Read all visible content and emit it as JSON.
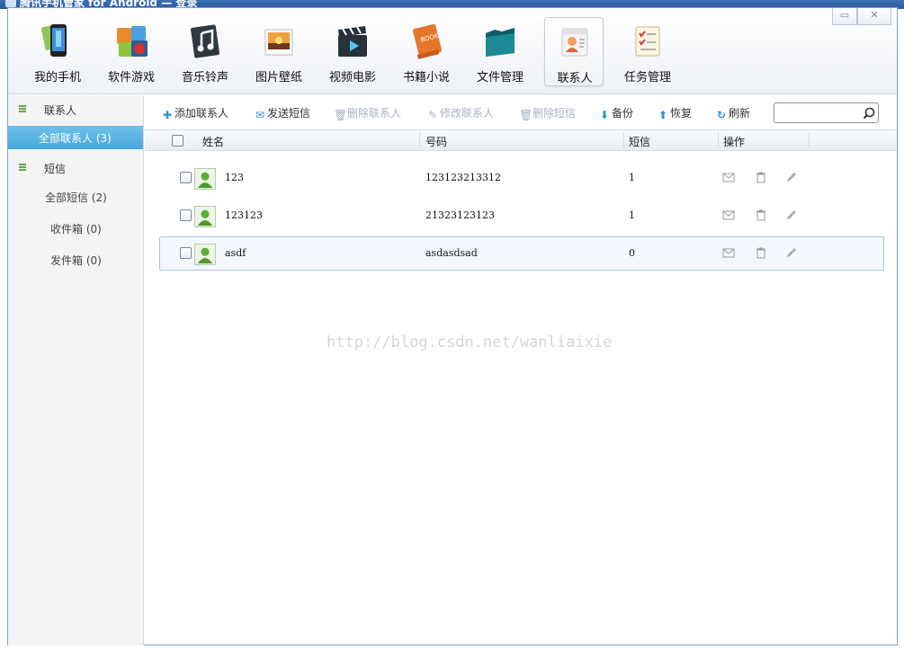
{
  "window": {
    "title": "腾讯手机管家 for Android — 登录",
    "minimize_label": "▭",
    "close_label": "✕"
  },
  "nav": {
    "items": [
      {
        "label": "我的手机",
        "icon": "phone-icon"
      },
      {
        "label": "软件游戏",
        "icon": "apps-games-icon"
      },
      {
        "label": "音乐铃声",
        "icon": "music-icon"
      },
      {
        "label": "图片壁纸",
        "icon": "wallpaper-icon"
      },
      {
        "label": "视频电影",
        "icon": "video-icon"
      },
      {
        "label": "书籍小说",
        "icon": "book-icon"
      },
      {
        "label": "文件管理",
        "icon": "folder-icon"
      },
      {
        "label": "联系人",
        "icon": "contacts-icon",
        "active": true
      },
      {
        "label": "任务管理",
        "icon": "tasks-icon"
      }
    ]
  },
  "sidebar": {
    "contacts_group": "联系人",
    "all_contacts": "全部联系人 (3)",
    "sms_group": "短信",
    "all_sms": "全部短信 (2)",
    "inbox": "收件箱 (0)",
    "outbox": "发件箱 (0)"
  },
  "toolbar": {
    "add_contact": "添加联系人",
    "send_sms": "发送短信",
    "delete_contact": "删除联系人",
    "edit_contact": "修改联系人",
    "delete_sms": "删除短信",
    "backup": "备份",
    "restore": "恢复",
    "refresh": "刷新",
    "search_value": ""
  },
  "table": {
    "headers": {
      "name": "姓名",
      "number": "号码",
      "sms": "短信",
      "actions": "操作"
    },
    "rows": [
      {
        "name": "123",
        "number": "123123213312",
        "sms": "1"
      },
      {
        "name": "123123",
        "number": "21323123123",
        "sms": "1"
      },
      {
        "name": "asdf",
        "number": "asdasdsad",
        "sms": "0"
      }
    ]
  },
  "watermark": "http://blog.csdn.net/wanliaixie",
  "colors": {
    "accent": "#47a7dc",
    "border": "#7fa3cf",
    "green": "#6aa04a"
  }
}
